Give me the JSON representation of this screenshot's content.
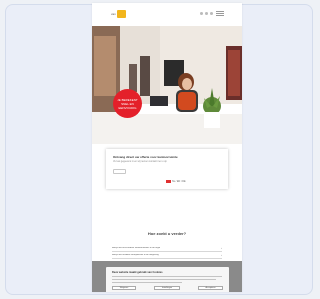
{
  "site": {
    "logo_text": "van",
    "header_icon_count": 3
  },
  "hero": {
    "badge_line1": "JE BEREKENT",
    "badge_line2": "SNEL EN",
    "badge_line3": "EENVOUDIG"
  },
  "form": {
    "title": "Ontvang direct uw offerte voor kantoorruimte",
    "subtitle": "Vul uw gegevens in en wij nemen contact met u op",
    "input_placeholder": "",
    "button_label": "NL / EN / DE"
  },
  "links": {
    "title": "Hoe zoekt u verder?",
    "items": [
      {
        "label": "Bekijk alle beschikbare kantoorruimtes in de regio"
      },
      {
        "label": "Bekijk alle flexibele werkplekken in de omgeving"
      },
      {
        "label": "Lees meer over huren van een bedrijfsruimte"
      }
    ]
  },
  "cookie": {
    "title": "Deze website maakt gebruik van Cookies",
    "button_decline": "Weigeren",
    "button_settings": "Instellingen",
    "button_accept": "Accepteren"
  },
  "colors": {
    "brand": "#f2b51c",
    "badge": "#e4202a",
    "overlay": "#8a8a8a"
  }
}
